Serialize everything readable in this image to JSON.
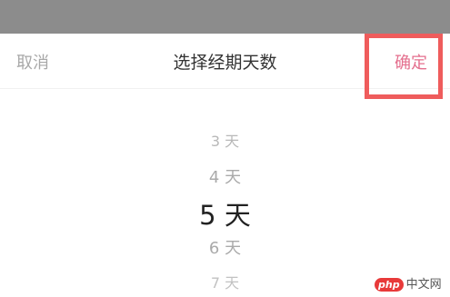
{
  "header": {
    "cancel_label": "取消",
    "title": "选择经期天数",
    "confirm_label": "确定"
  },
  "picker": {
    "options": [
      "3 天",
      "4 天",
      "5 天",
      "6 天",
      "7 天"
    ],
    "selected": "5 天"
  },
  "watermark": {
    "logo": "php",
    "text": "中文网"
  },
  "colors": {
    "confirm": "#e46f8e",
    "highlight": "#ef5c5c",
    "status_bar": "#8c8c8c"
  }
}
